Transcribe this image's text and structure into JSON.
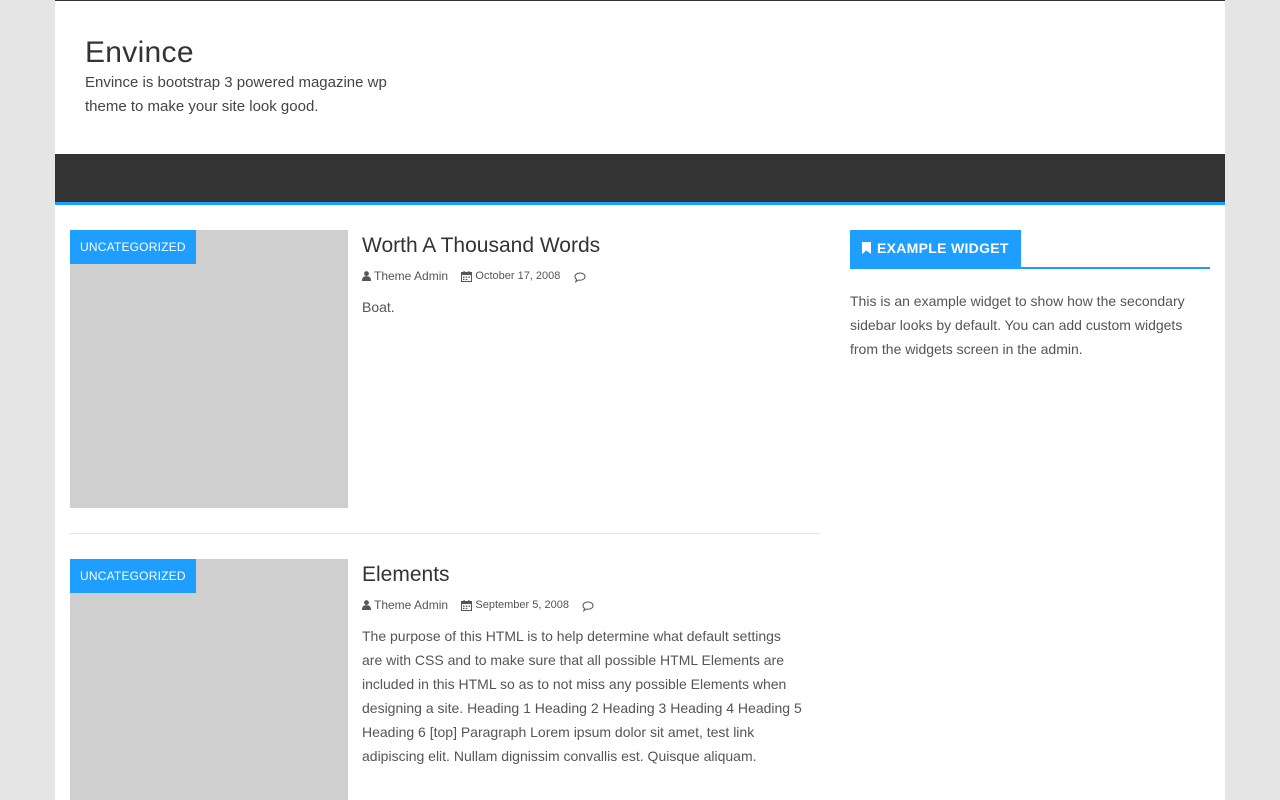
{
  "site": {
    "title": "Envince",
    "description": "Envince is bootstrap 3 powered magazine wp theme to make your site look good."
  },
  "colors": {
    "accent": "#1e9fff",
    "nav_background": "#333333",
    "thumbnail_placeholder": "#cfcfcf",
    "page_background": "#e5e5e5"
  },
  "posts": [
    {
      "category": "UNCATEGORIZED",
      "title": "Worth A Thousand Words",
      "author": "Theme Admin",
      "date": "October 17, 2008",
      "excerpt": "Boat.",
      "icons": [
        "user-icon",
        "calendar-icon",
        "comment-icon"
      ]
    },
    {
      "category": "UNCATEGORIZED",
      "title": "Elements",
      "author": "Theme Admin",
      "date": "September 5, 2008",
      "excerpt": "The purpose of this HTML is to help determine what default settings are with CSS and to make sure that all possible HTML Elements are included in this HTML so as to not miss any possible Elements when designing a site. Heading 1 Heading 2 Heading 3 Heading 4 Heading 5 Heading 6 [top] Paragraph Lorem ipsum dolor sit amet, test link adipiscing elit. Nullam dignissim convallis est. Quisque aliquam.",
      "icons": [
        "user-icon",
        "calendar-icon",
        "comment-icon"
      ]
    }
  ],
  "sidebar": {
    "widget_title": "EXAMPLE WIDGET",
    "widget_icon": "bookmark-icon",
    "widget_text": "This is an example widget to show how the secondary sidebar looks by default. You can add custom widgets from the widgets screen in the admin."
  }
}
